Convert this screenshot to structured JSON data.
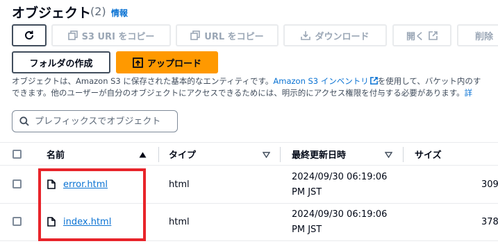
{
  "header": {
    "title": "オブジェクト",
    "count": "(2)",
    "info_link": "情報"
  },
  "toolbar": {
    "refresh_icon": "refresh-icon",
    "copy_s3_uri": "S3 URI をコピー",
    "copy_url": "URL をコピー",
    "download": "ダウンロード",
    "open": "開く",
    "delete": "削除",
    "create_folder": "フォルダの作成",
    "upload": "アップロード",
    "upload_color": "#ff9900"
  },
  "description": {
    "line1_before": "オブジェクトは、Amazon S3 に保存された基本的なエンティティです。",
    "inventory_link": "Amazon S3 インベントリ",
    "line1_after": "を使用して、バケット内のす",
    "line2": "できます。他のユーザーが自分のオブジェクトにアクセスできるためには、明示的にアクセス権限を付与する必要があります。",
    "details_link": "詳"
  },
  "search": {
    "placeholder": "プレフィックスでオブジェクト"
  },
  "table": {
    "columns": {
      "name": "名前",
      "type": "タイプ",
      "modified": "最終更新日時",
      "size": "サイズ"
    },
    "rows": [
      {
        "name": "error.html",
        "type": "html",
        "modified_line1": "2024/09/30 06:19:06",
        "modified_line2": "PM JST",
        "size": "309"
      },
      {
        "name": "index.html",
        "type": "html",
        "modified_line1": "2024/09/30 06:19:06",
        "modified_line2": "PM JST",
        "size": "378"
      }
    ]
  },
  "highlight_color": "#e8242a"
}
